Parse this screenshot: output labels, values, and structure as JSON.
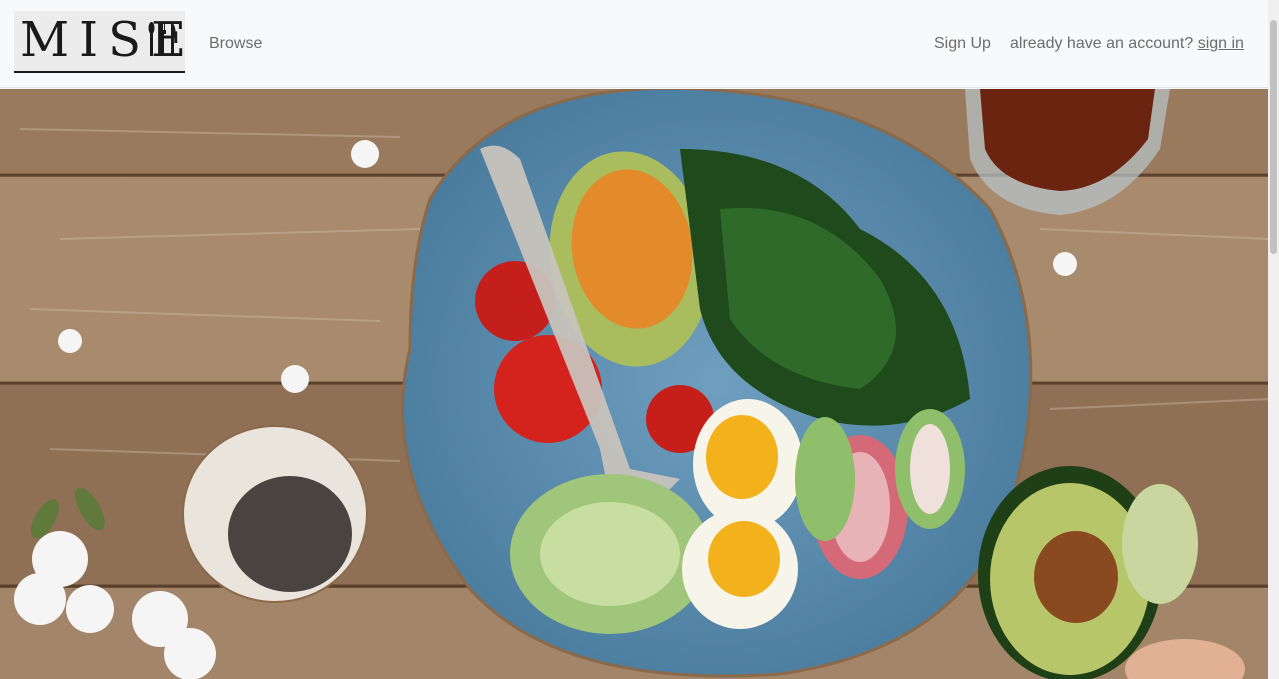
{
  "brand": {
    "logo_text": "MISE"
  },
  "nav": {
    "browse_label": "Browse",
    "signup_label": "Sign Up",
    "account_prompt": "already have an account?",
    "signin_label": "sign in"
  },
  "hero": {
    "image": "food-bowl-photo"
  }
}
